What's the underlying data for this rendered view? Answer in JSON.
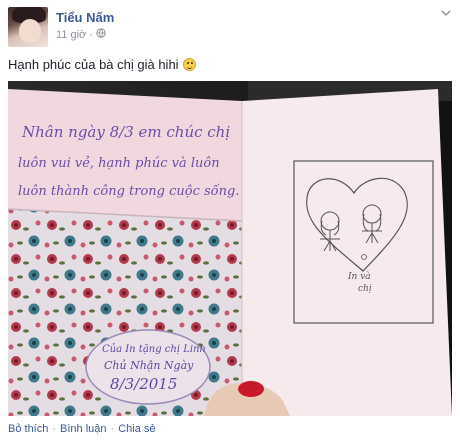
{
  "post": {
    "author_name": "Tiểu Nấm",
    "time": "11 giờ",
    "status_text": "Hạnh phúc của bà chị già hihi",
    "card_text_line1": "Nhân ngày 8/3 em chúc chị",
    "card_text_line2": "luôn vui vẻ, hạnh phúc và luôn",
    "card_text_line3": "luôn thành công trong cuộc sống.",
    "envelope_line1": "Của In tặng chị Linh",
    "envelope_line2": "Chủ Nhận Ngày",
    "envelope_line3": "8/3/2015",
    "drawing_caption_line1": "In và",
    "drawing_caption_line2": "chị"
  },
  "actions": {
    "like": "Bỏ thích",
    "comment": "Bình luận",
    "share": "Chia sẻ",
    "separator": "·"
  },
  "icons": {
    "audience": "globe-icon",
    "menu": "chevron-down-icon",
    "emoji": "smiley-icon"
  },
  "colors": {
    "author": "#3b5998",
    "meta": "#90949c",
    "card_text": "#6a4ea8"
  }
}
